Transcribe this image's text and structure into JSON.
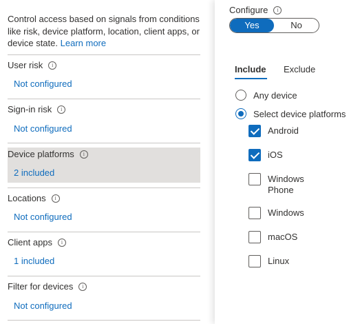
{
  "intro": {
    "text": "Control access based on signals from conditions like risk, device platform, location, client apps, or device state.",
    "learn_more": "Learn more"
  },
  "conditions": [
    {
      "label": "User risk",
      "value": "Not configured"
    },
    {
      "label": "Sign-in risk",
      "value": "Not configured"
    },
    {
      "label": "Device platforms",
      "value": "2 included",
      "selected": true
    },
    {
      "label": "Locations",
      "value": "Not configured"
    },
    {
      "label": "Client apps",
      "value": "1 included"
    },
    {
      "label": "Filter for devices",
      "value": "Not configured"
    }
  ],
  "configure": {
    "label": "Configure",
    "yes": "Yes",
    "no": "No",
    "selected": "Yes"
  },
  "tabs": [
    {
      "label": "Include",
      "active": true
    },
    {
      "label": "Exclude",
      "active": false
    }
  ],
  "device_options": [
    {
      "label": "Any device",
      "selected": false
    },
    {
      "label": "Select device platforms",
      "selected": true
    }
  ],
  "platforms": [
    {
      "label": "Android",
      "checked": true
    },
    {
      "label": "iOS",
      "checked": true
    },
    {
      "label_line1": "Windows",
      "label_line2": "Phone",
      "checked": false
    },
    {
      "label": "Windows",
      "checked": false
    },
    {
      "label": "macOS",
      "checked": false
    },
    {
      "label": "Linux",
      "checked": false
    }
  ],
  "colors": {
    "accent": "#0f6cbd",
    "selected_row": "#e1dfdd"
  },
  "icons": [
    "info-icon"
  ]
}
